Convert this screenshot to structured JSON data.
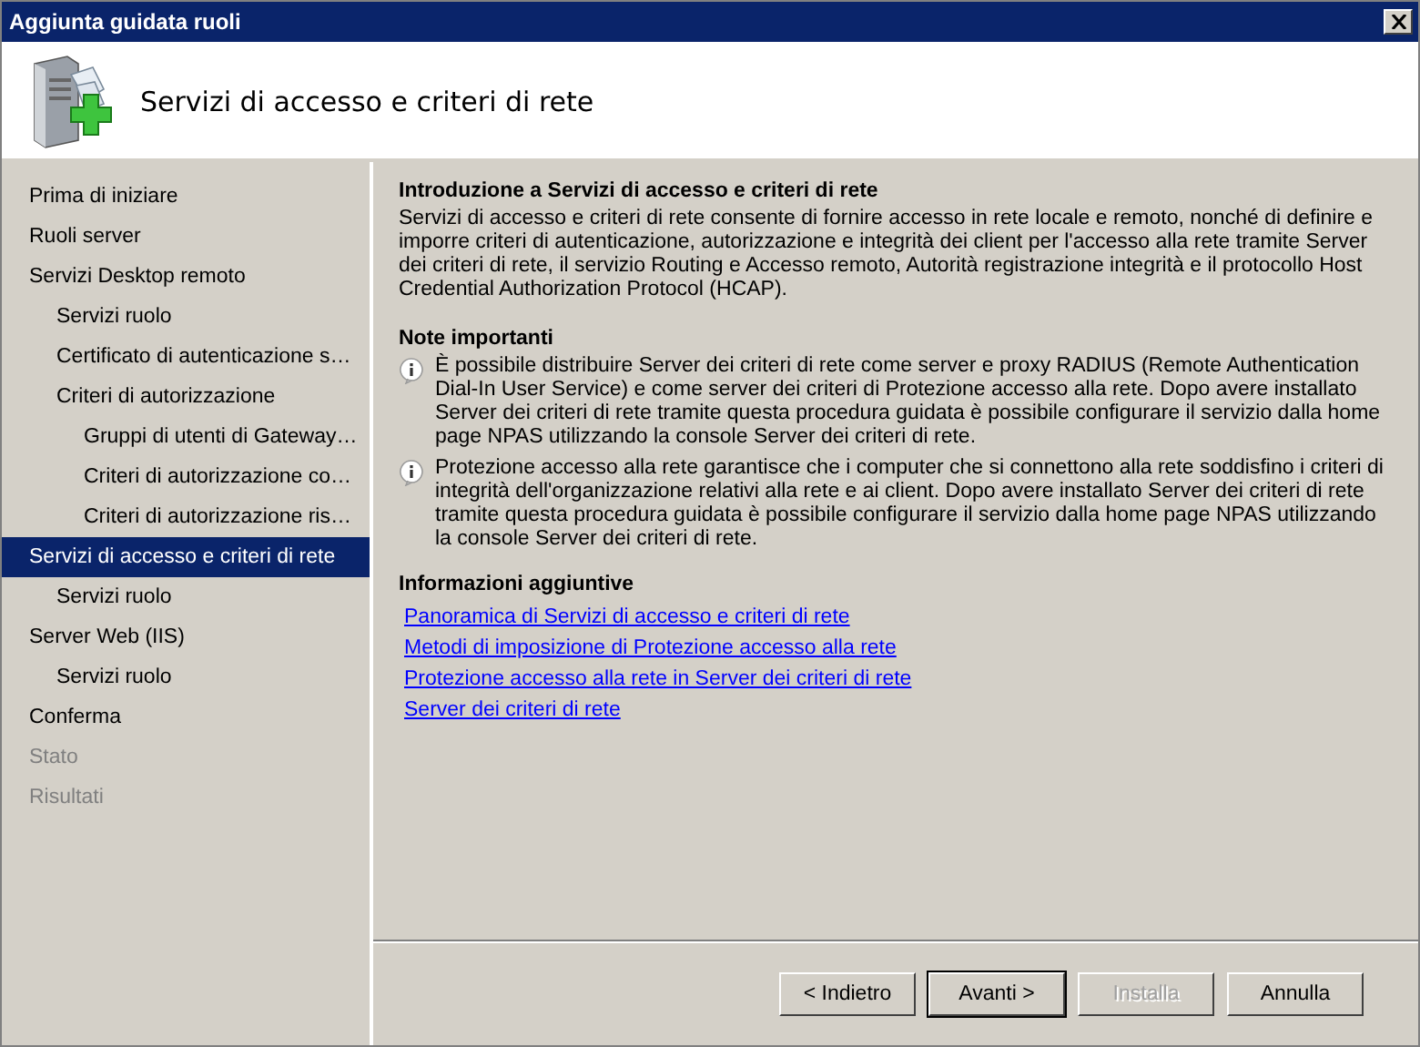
{
  "window": {
    "title": "Aggiunta guidata ruoli"
  },
  "header": {
    "title": "Servizi di accesso e criteri di rete"
  },
  "sidebar": {
    "items": [
      {
        "label": "Prima di iniziare",
        "selected": false,
        "disabled": false
      },
      {
        "label": "Ruoli server",
        "selected": false,
        "disabled": false
      },
      {
        "label": "Servizi Desktop remoto",
        "selected": false,
        "disabled": false,
        "children": [
          {
            "label": "Servizi ruolo",
            "selected": false,
            "disabled": false
          },
          {
            "label": "Certificato di autenticazione s…",
            "selected": false,
            "disabled": false
          },
          {
            "label": "Criteri di autorizzazione",
            "selected": false,
            "disabled": false,
            "children": [
              {
                "label": "Gruppi di utenti di Gateway…",
                "selected": false,
                "disabled": false
              },
              {
                "label": "Criteri di autorizzazione co…",
                "selected": false,
                "disabled": false
              },
              {
                "label": "Criteri di autorizzazione ris…",
                "selected": false,
                "disabled": false
              }
            ]
          }
        ]
      },
      {
        "label": "Servizi di accesso e criteri di rete",
        "selected": true,
        "disabled": false,
        "children": [
          {
            "label": "Servizi ruolo",
            "selected": false,
            "disabled": false
          }
        ]
      },
      {
        "label": "Server Web (IIS)",
        "selected": false,
        "disabled": false,
        "children": [
          {
            "label": "Servizi ruolo",
            "selected": false,
            "disabled": false
          }
        ]
      },
      {
        "label": "Conferma",
        "selected": false,
        "disabled": false
      },
      {
        "label": "Stato",
        "selected": false,
        "disabled": true
      },
      {
        "label": "Risultati",
        "selected": false,
        "disabled": true
      }
    ]
  },
  "content": {
    "intro_heading": "Introduzione a Servizi di accesso e criteri di rete",
    "intro_text": "Servizi di accesso e criteri di rete consente di fornire accesso in rete locale e remoto, nonché di definire e imporre criteri di autenticazione, autorizzazione e integrità dei client per l'accesso alla rete tramite Server dei criteri di rete, il servizio Routing e Accesso remoto, Autorità registrazione integrità e il protocollo Host Credential Authorization Protocol (HCAP).",
    "notes_heading": "Note importanti",
    "notes": [
      "È possibile distribuire Server dei criteri di rete come server e proxy RADIUS (Remote Authentication Dial-In User Service) e come server dei criteri di Protezione accesso alla rete. Dopo avere installato Server dei criteri di rete tramite questa procedura guidata è possibile configurare il servizio dalla home page NPAS utilizzando la console Server dei criteri di rete.",
      "Protezione accesso alla rete garantisce che i computer che si connettono alla rete soddisfino i criteri di integrità dell'organizzazione relativi alla rete e ai client. Dopo avere installato Server dei criteri di rete tramite questa procedura guidata è possibile configurare il servizio dalla home page NPAS utilizzando la console Server dei criteri di rete."
    ],
    "more_heading": "Informazioni aggiuntive",
    "links": [
      "Panoramica di Servizi di accesso e criteri di rete",
      "Metodi di imposizione di Protezione accesso alla rete",
      "Protezione accesso alla rete in Server dei criteri di rete",
      "Server dei criteri di rete"
    ]
  },
  "buttons": [
    {
      "label": "< Indietro",
      "disabled": false,
      "default": false
    },
    {
      "label": "Avanti >",
      "disabled": false,
      "default": true
    },
    {
      "label": "Installa",
      "disabled": true,
      "default": false
    },
    {
      "label": "Annulla",
      "disabled": false,
      "default": false
    }
  ]
}
